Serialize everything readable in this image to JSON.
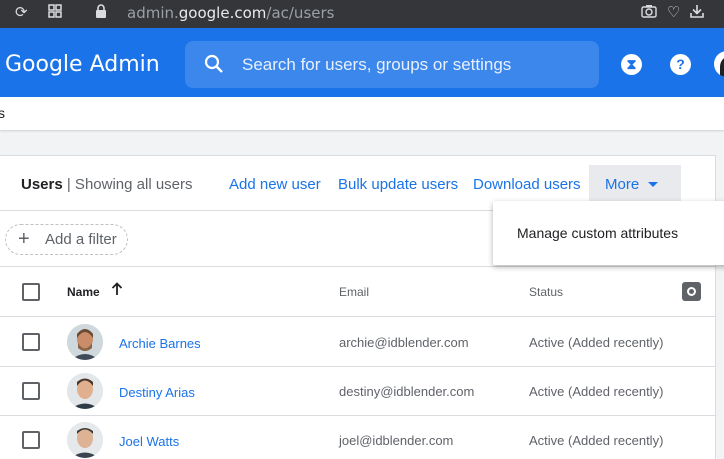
{
  "browser": {
    "url_prefix": "admin.",
    "url_host": "google.com",
    "url_path": "/ac/users"
  },
  "header": {
    "logo": "Google Admin",
    "search_placeholder": "Search for users, groups or settings",
    "hourglass_icon": "hourglass-icon",
    "help_label": "?"
  },
  "breadcrumb": {
    "fragment": "s"
  },
  "toolbar": {
    "title_bold": "Users",
    "title_rest": " | Showing all users",
    "add_new_user": "Add new user",
    "bulk_update_users": "Bulk update users",
    "download_users": "Download users",
    "more": "More"
  },
  "filter": {
    "add_filter": "Add a filter",
    "plus": "+"
  },
  "table": {
    "columns": {
      "name": "Name",
      "email": "Email",
      "status": "Status"
    },
    "rows": [
      {
        "name": "Archie Barnes",
        "email": "archie@idblender.com",
        "status": "Active (Added recently)"
      },
      {
        "name": "Destiny Arias",
        "email": "destiny@idblender.com",
        "status": "Active (Added recently)"
      },
      {
        "name": "Joel Watts",
        "email": "joel@idblender.com",
        "status": "Active (Added recently)"
      }
    ]
  },
  "more_menu": {
    "manage_custom_attributes": "Manage custom attributes"
  },
  "colors": {
    "accent": "#1a73e8",
    "header": "#1a73e8",
    "chrome": "#35363a"
  }
}
